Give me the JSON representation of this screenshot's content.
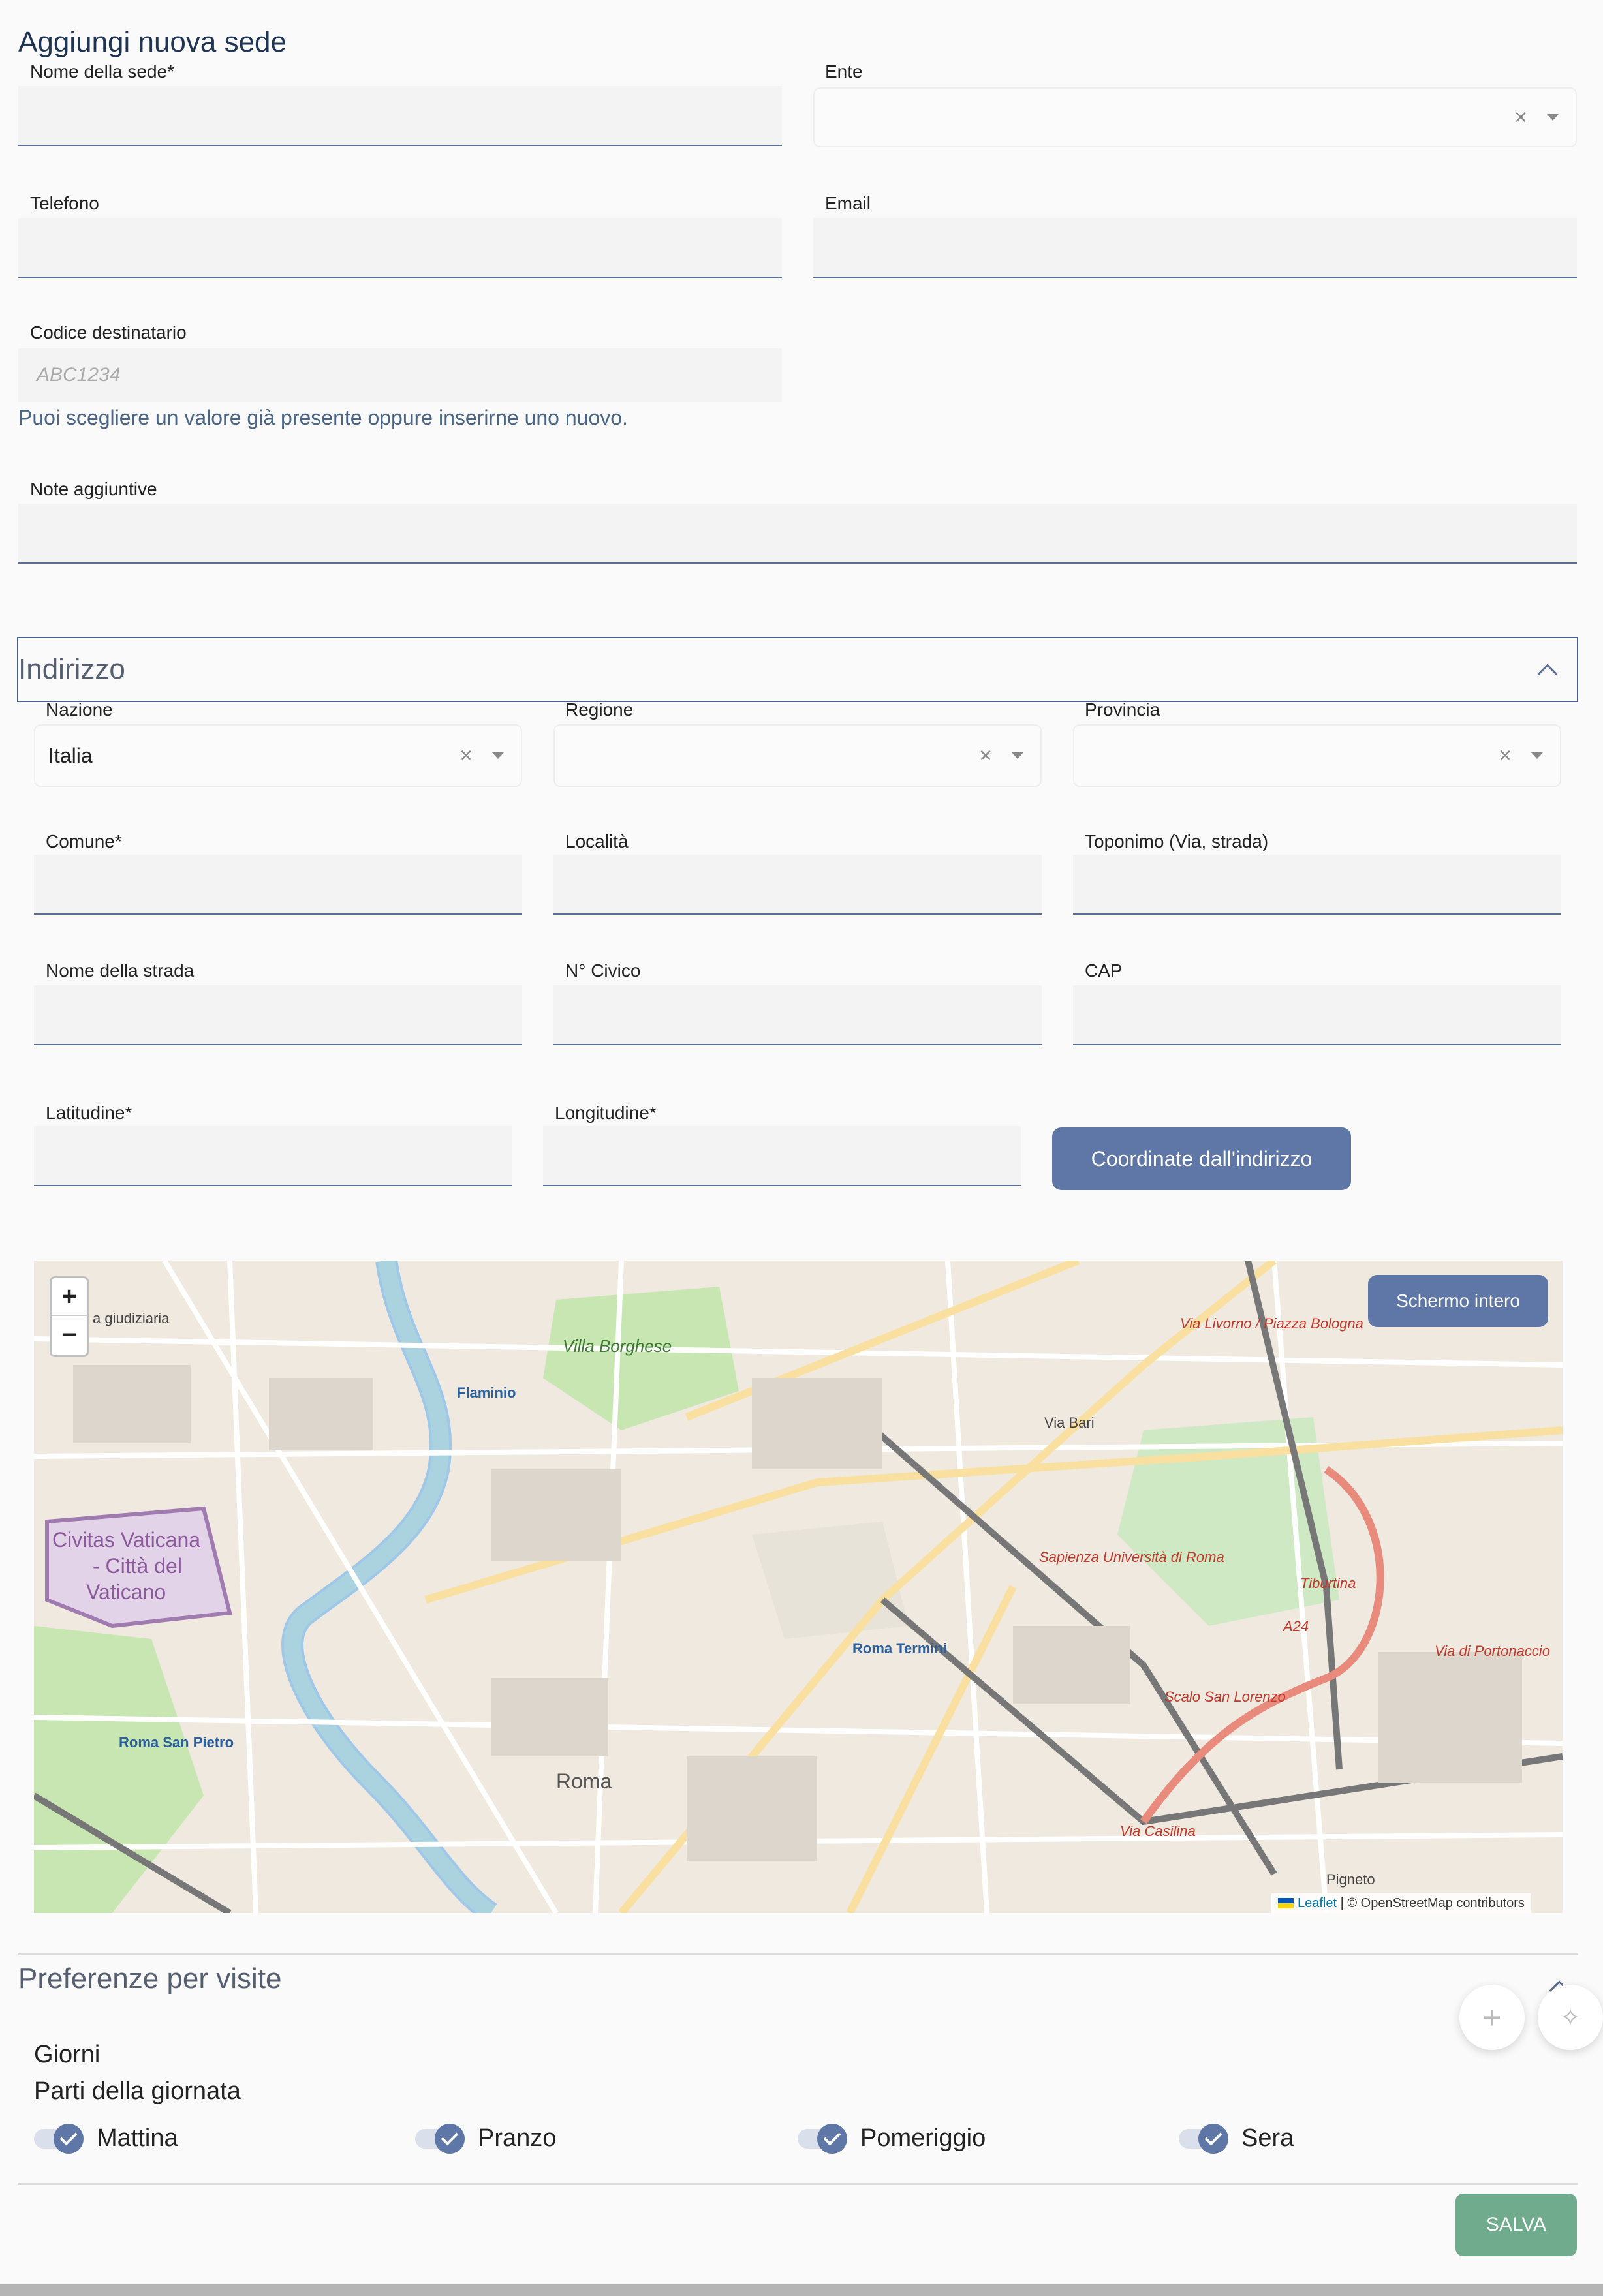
{
  "page": {
    "title": "Aggiungi nuova sede"
  },
  "form": {
    "nome_sede": {
      "label": "Nome della sede*",
      "value": ""
    },
    "ente": {
      "label": "Ente",
      "value": ""
    },
    "telefono": {
      "label": "Telefono",
      "value": ""
    },
    "email": {
      "label": "Email",
      "value": ""
    },
    "codice_destinatario": {
      "label": "Codice destinatario",
      "placeholder": "ABC1234",
      "hint": "Puoi scegliere un valore già presente oppure inserirne uno nuovo."
    },
    "note": {
      "label": "Note aggiuntive",
      "value": ""
    }
  },
  "indirizzo": {
    "title": "Indirizzo",
    "nazione": {
      "label": "Nazione",
      "value": "Italia"
    },
    "regione": {
      "label": "Regione",
      "value": ""
    },
    "provincia": {
      "label": "Provincia",
      "value": ""
    },
    "comune": {
      "label": "Comune*"
    },
    "localita": {
      "label": "Località"
    },
    "toponimo": {
      "label": "Toponimo (Via, strada)"
    },
    "strada": {
      "label": "Nome della strada"
    },
    "civico": {
      "label": "N° Civico"
    },
    "cap": {
      "label": "CAP"
    },
    "latitudine": {
      "label": "Latitudine*"
    },
    "longitudine": {
      "label": "Longitudine*"
    },
    "coord_button": "Coordinate dall'indirizzo"
  },
  "map": {
    "fullscreen": "Schermo intero",
    "zoom_in": "+",
    "zoom_out": "−",
    "attribution_link": "Leaflet",
    "attribution_text": "| © OpenStreetMap contributors",
    "labels": {
      "vaticano": "Civitas Vaticana",
      "citta": "- Città del",
      "vaticano2": "Vaticano",
      "villa": "Villa Borghese",
      "flaminio": "Flaminio",
      "roma": "Roma",
      "termini": "Roma Termini",
      "tiburtina": "Tiburtina",
      "pigneto": "Pigneto",
      "san_pietro": "Roma San Pietro",
      "sapienza": "Sapienza Università di Roma",
      "via_bari": "Via Bari",
      "via_livorno": "Via Livorno / Piazza Bologna",
      "scalo": "Scalo San Lorenzo",
      "giudiziaria": "a giudiziaria",
      "a24": "A24",
      "portonaccio": "Via di Portonaccio",
      "casilina": "Via Casilina"
    }
  },
  "preferenze": {
    "title": "Preferenze per visite",
    "giorni": "Giorni",
    "parti": "Parti della giornata",
    "toggles": [
      {
        "label": "Mattina",
        "checked": true
      },
      {
        "label": "Pranzo",
        "checked": true
      },
      {
        "label": "Pomeriggio",
        "checked": true
      },
      {
        "label": "Sera",
        "checked": true
      }
    ]
  },
  "actions": {
    "save": "SALVA"
  },
  "icons": {
    "clear": "×",
    "fab_add": "+",
    "fab_magic": "✧"
  },
  "colors": {
    "primary": "#5e77a6",
    "save": "#6fab8c",
    "title": "#1f3553"
  }
}
